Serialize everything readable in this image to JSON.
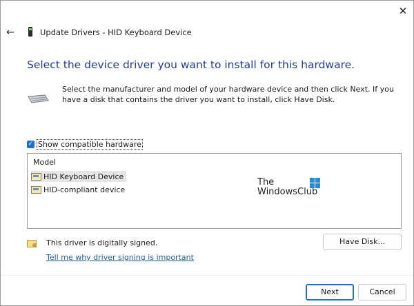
{
  "window": {
    "title": "Update Drivers - HID Keyboard Device",
    "close_glyph": "✕",
    "back_glyph": "←"
  },
  "heading": "Select the device driver you want to install for this hardware.",
  "instructions": "Select the manufacturer and model of your hardware device and then click Next. If you have a disk that contains the driver you want to install, click Have Disk.",
  "compatible": {
    "label": "Show compatible hardware",
    "checked": true,
    "check_glyph": "✓"
  },
  "model_list": {
    "header": "Model",
    "items": [
      {
        "label": "HID Keyboard Device",
        "selected": true
      },
      {
        "label": "HID-compliant device",
        "selected": false
      }
    ]
  },
  "watermark": {
    "line1": "The",
    "line2": "WindowsClub"
  },
  "signing": {
    "status": "This driver is digitally signed.",
    "link": "Tell me why driver signing is important"
  },
  "buttons": {
    "have_disk": "Have Disk...",
    "next": "Next",
    "cancel": "Cancel"
  },
  "colors": {
    "heading": "#1d3f9a",
    "accent": "#1f6fd1",
    "link": "#1a5fb4"
  }
}
